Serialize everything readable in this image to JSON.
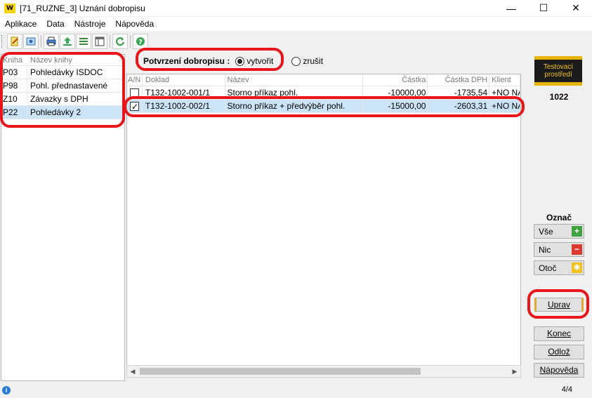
{
  "window": {
    "logo": "W",
    "title": "[71_RUZNE_3] Uznání dobropisu",
    "minimize": "—",
    "maximize": "☐",
    "close": "✕"
  },
  "menu": [
    "Aplikace",
    "Data",
    "Nástroje",
    "Nápověda"
  ],
  "toolbar": {
    "icons": [
      "edit-icon",
      "preview-icon",
      "print-icon",
      "export-icon",
      "list-icon",
      "columns-icon",
      "refresh-icon",
      "help-icon"
    ]
  },
  "books": {
    "headers": {
      "code": "Kniha",
      "name": "Název knihy"
    },
    "rows": [
      {
        "code": "P03",
        "name": "Pohledávky ISDOC"
      },
      {
        "code": "P98",
        "name": "Pohl. přednastavené"
      },
      {
        "code": "Z10",
        "name": "Závazky s DPH"
      },
      {
        "code": "P22",
        "name": "Pohledávky 2"
      }
    ],
    "selected_index": 3
  },
  "confirm": {
    "label": "Potvrzení dobropisu :",
    "options": [
      "vytvořit",
      "zrušit"
    ],
    "selected": "vytvořit"
  },
  "grid": {
    "headers": {
      "an": "A/N",
      "doklad": "Doklad",
      "nazev": "Název",
      "castka": "Částka",
      "dph": "Částka DPH",
      "klient": "Klient"
    },
    "rows": [
      {
        "checked": false,
        "doklad": "T132-1002-001/1",
        "nazev": "Storno příkaz pohl.",
        "castka": "-10000,00",
        "dph": "-1735,54",
        "klient": "+NO NAI"
      },
      {
        "checked": true,
        "doklad": "T132-1002-002/1",
        "nazev": "Storno příkaz + předvýběr pohl.",
        "castka": "-15000,00",
        "dph": "-2603,31",
        "klient": "+NO NAI"
      }
    ]
  },
  "right": {
    "env_badge": "Testovací prostředí",
    "counter": "1022",
    "oznac_label": "Označ",
    "buttons": {
      "vse": "Vše",
      "nic": "Nic",
      "otoc": "Otoč",
      "uprav": "Uprav",
      "konec": "Konec",
      "odloz": "Odlož",
      "napoveda": "Nápověda"
    }
  },
  "status": {
    "info": "i",
    "page": "4/4"
  },
  "colors": {
    "highlight": "#e8151b",
    "selection": "#cce4f7",
    "accent": "#f7d312"
  }
}
